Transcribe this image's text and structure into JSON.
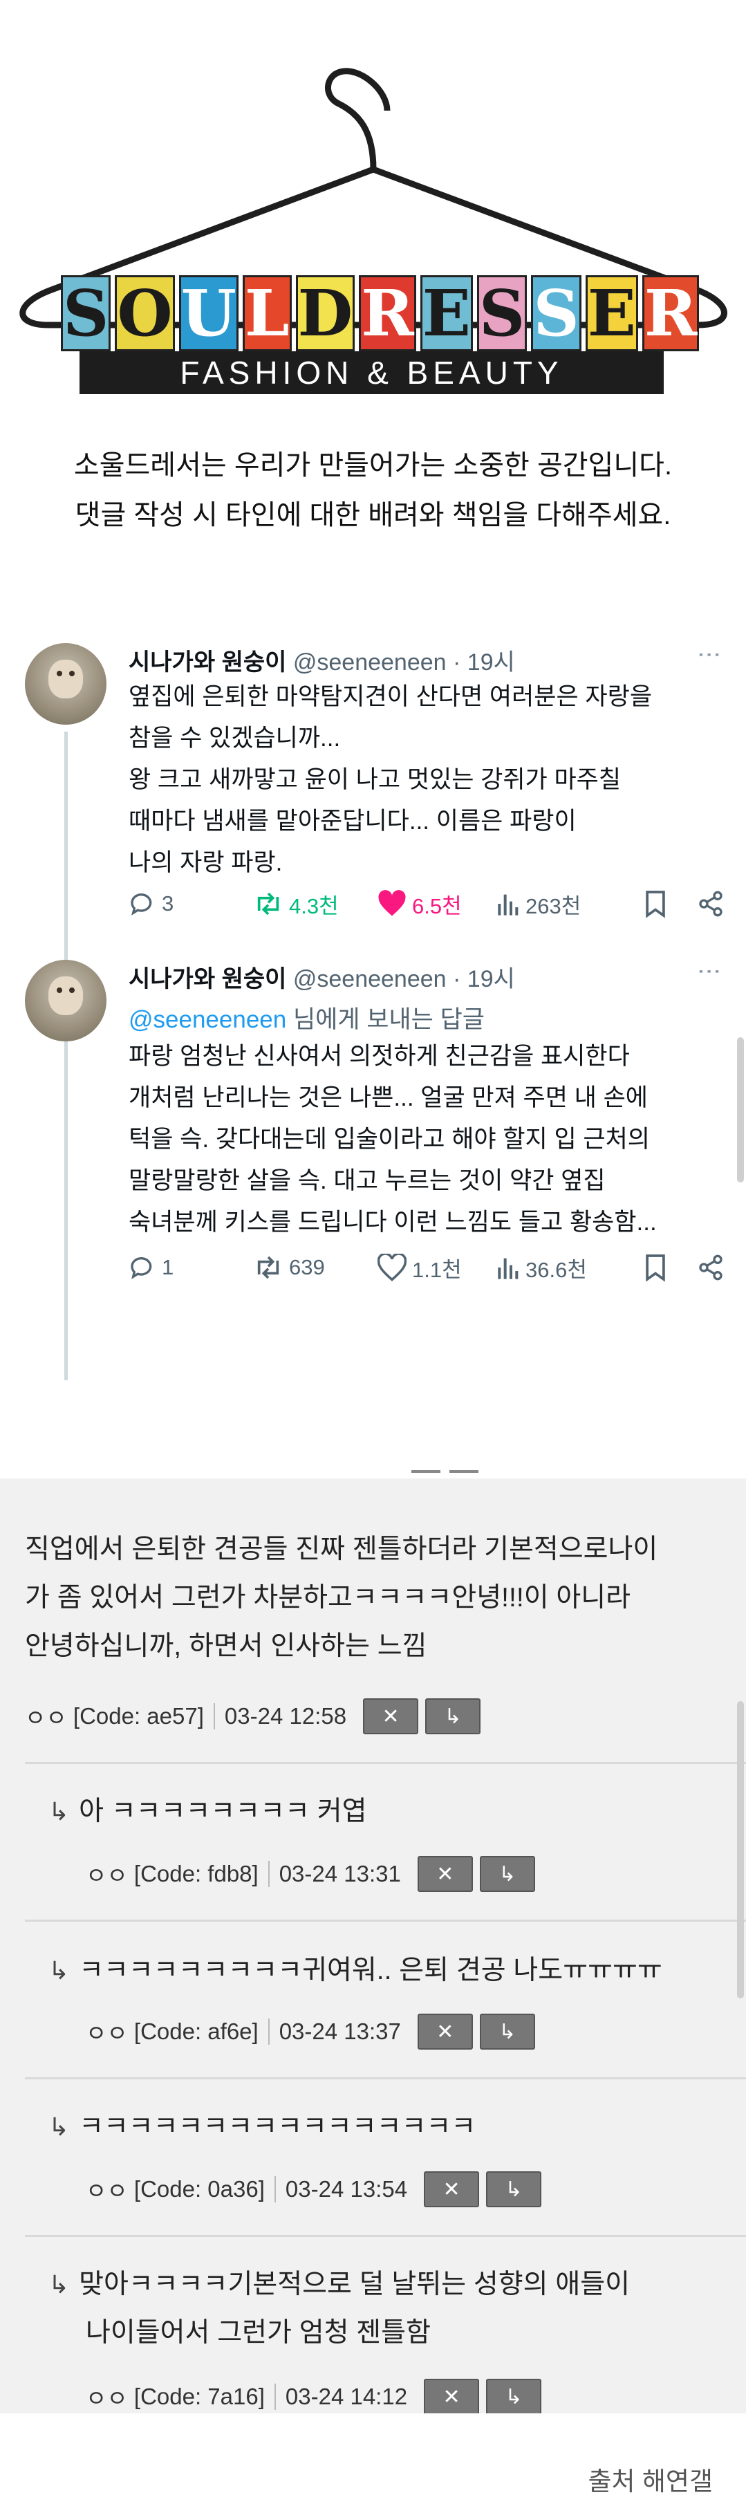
{
  "logo": {
    "letters": [
      "S",
      "O",
      "U",
      "L",
      "D",
      "R",
      "E",
      "S",
      "S",
      "E",
      "R"
    ],
    "letter_colors": [
      "#6fbcd3",
      "#e9d542",
      "#2a9ad1",
      "#e5472a",
      "#f2e24d",
      "#df3a2f",
      "#6fbcd3",
      "#e8a3c2",
      "#5cb5d6",
      "#f3d23c",
      "#e24b2c"
    ],
    "letter_text_colors": [
      "#1b1b1b",
      "#1b1b1b",
      "#ffffff",
      "#ffffff",
      "#1b1b1b",
      "#ffffff",
      "#1b1b1b",
      "#1b1b1b",
      "#ffffff",
      "#1b1b1b",
      "#ffffff"
    ],
    "subtitle": "FASHION & BEAUTY"
  },
  "notice": {
    "line1": "소울드레서는 우리가 만들어가는 소중한 공간입니다.",
    "line2": "댓글 작성 시 타인에 대한 배려와 책임을 다해주세요."
  },
  "tweets": [
    {
      "name": "시나가와 원숭이",
      "handle": "@seeneeneen",
      "time": "· 19시",
      "more": "⋮",
      "body": [
        "옆집에 은퇴한 마약탐지견이 산다면 여러분은 자랑을",
        "참을 수 있겠습니까...",
        "왕 크고 새까맣고 윤이 나고 멋있는 강쥐가 마주칠",
        "때마다 냄새를 맡아준답니다... 이름은 파랑이",
        "나의 자랑 파랑."
      ],
      "replies": "3",
      "retweets": "4.3천",
      "likes": "6.5천",
      "views": "263천",
      "liked": true,
      "retweeted": true
    },
    {
      "name": "시나가와 원숭이",
      "handle": "@seeneeneen",
      "time": "· 19시",
      "more": "⋮",
      "reply_to_handle": "@seeneeneen",
      "reply_to_suffix": " 님에게 보내는 답글",
      "body": [
        "파랑 엄청난 신사여서 의젓하게 친근감을 표시한다",
        "개처럼 난리나는 것은 나쁜... 얼굴 만져 주면 내 손에",
        "턱을 슥. 갖다대는데 입술이라고 해야 할지 입 근처의",
        "말랑말랑한 살을 슥. 대고 누르는 것이 약간 옆집",
        "숙녀분께 키스를 드립니다 이런 느낌도 들고 황송함..."
      ],
      "replies": "1",
      "retweets": "639",
      "likes": "1.1천",
      "views": "36.6천",
      "liked": false,
      "retweeted": false
    }
  ],
  "comments": {
    "main": {
      "lines": [
        "직업에서 은퇴한 견공들 진짜 젠틀하더라 기본적으로나이",
        "가 좀 있어서 그런가 차분하고ㅋㅋㅋㅋ안녕!!!이 아니라",
        "안녕하십니까, 하면서 인사하는 느낌"
      ],
      "author": "ㅇㅇ",
      "code": "[Code: ae57]",
      "date": "03-24 12:58"
    },
    "replies": [
      {
        "text": "아 ㅋㅋㅋㅋㅋㅋㅋㅋ 커엽",
        "author": "ㅇㅇ",
        "code": "[Code: fdb8]",
        "date": "03-24 13:31"
      },
      {
        "text": "ㅋㅋㅋㅋㅋㅋㅋㅋㅋ귀여워.. 은퇴 견공 나도ㅠㅠㅠㅠ",
        "author": "ㅇㅇ",
        "code": "[Code: af6e]",
        "date": "03-24 13:37"
      },
      {
        "text": "ㅋㅋㅋㅋㅋㅋㅋㅋㅋㅋㅋㅋㅋㅋㅋㅋ",
        "author": "ㅇㅇ",
        "code": "[Code: 0a36]",
        "date": "03-24 13:54"
      },
      {
        "text": "맞아ㅋㅋㅋㅋ기본적으로 덜 날뛰는 성향의 애들이",
        "text2": "나이들어서 그런가 엄청 젠틀함",
        "author": "ㅇㅇ",
        "code": "[Code: 7a16]",
        "date": "03-24 14:12"
      }
    ],
    "delete_icon": "✕",
    "reply_icon": "↳"
  },
  "source": "출처 해연갤"
}
